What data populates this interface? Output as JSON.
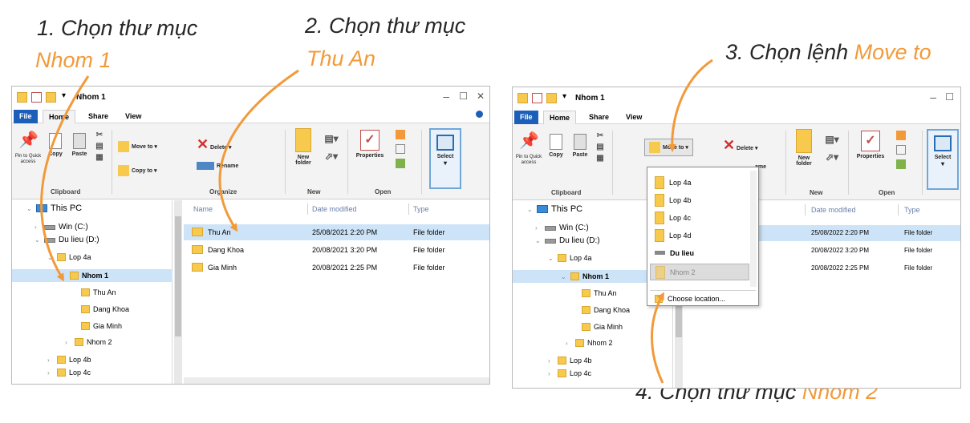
{
  "captions": {
    "step1_line1": "1. Chọn thư mục",
    "step1_line2": "Nhom 1",
    "step2_line1": "2. Chọn thư mục",
    "step2_line2": "Thu An",
    "step3_prefix": "3. Chọn lệnh",
    "step3_highlight": "Move to",
    "step4_prefix": "4. Chọn thư mục",
    "step4_highlight": "Nhom 2",
    "accent_color": "#f29a3a"
  },
  "window_left": {
    "title": "Nhom 1",
    "controls": [
      "–",
      "☐",
      "✕"
    ],
    "tabs": [
      "File",
      "Home",
      "Share",
      "View"
    ],
    "ribbon": {
      "pin_label": "Pin to Quick access",
      "copy_label": "Copy",
      "paste_label": "Paste",
      "clipboard_group": "Clipboard",
      "move_to_label": "Move to ▾",
      "copy_to_label": "Copy to ▾",
      "delete_label": "Delete ▾",
      "rename_label": "Rename",
      "organize_group": "Organize",
      "new_folder_label": "New folder",
      "new_group": "New",
      "properties_label": "Properties",
      "open_group": "Open",
      "select_label": "Select"
    },
    "nav": [
      "This PC",
      "Win (C:)",
      "Du lieu (D:)",
      "Lop 4a",
      "Nhom 1",
      "Thu An",
      "Dang Khoa",
      "Gia Minh",
      "Nhom 2",
      "Lop 4b",
      "Lop 4c"
    ],
    "columns": [
      "Name",
      "Date modified",
      "Type"
    ],
    "rows": [
      {
        "name": "Thu An",
        "date": "25/08/2021 2:20 PM",
        "type": "File folder"
      },
      {
        "name": "Dang Khoa",
        "date": "20/08/2021 3:20 PM",
        "type": "File folder"
      },
      {
        "name": "Gia Minh",
        "date": "20/08/2021 2:25 PM",
        "type": "File folder"
      }
    ]
  },
  "window_right": {
    "title": "Nhom 1",
    "tabs": [
      "File",
      "Home",
      "Share",
      "View"
    ],
    "ribbon": {
      "pin_label": "Pin to Quick access",
      "copy_label": "Copy",
      "paste_label": "Paste",
      "clipboard_group": "Clipboard",
      "move_to_label": "Move to ▾",
      "delete_label": "Delete ▾",
      "rename_partial": "ame",
      "new_folder_label": "New folder",
      "new_group": "New",
      "properties_label": "Properties",
      "open_group": "Open",
      "select_label": "Select"
    },
    "nav": [
      "This PC",
      "Win (C:)",
      "Du lieu (D:)",
      "Lop 4a",
      "Nhom 1",
      "Thu An",
      "Dang Khoa",
      "Gia Minh",
      "Nhom 2",
      "Lop 4b",
      "Lop 4c"
    ],
    "columns": [
      "Date modified",
      "Type"
    ],
    "rows": [
      {
        "date": "25/08/2022 2:20 PM",
        "type": "File folder"
      },
      {
        "date": "20/08/2022 3:20 PM",
        "type": "File folder"
      },
      {
        "date": "20/08/2022 2:25 PM",
        "type": "File folder"
      }
    ],
    "dropdown": [
      "Lop 4a",
      "Lop 4b",
      "Lop 4c",
      "Lop 4d",
      "Du lieu",
      "Nhom 2",
      "Choose location..."
    ]
  }
}
